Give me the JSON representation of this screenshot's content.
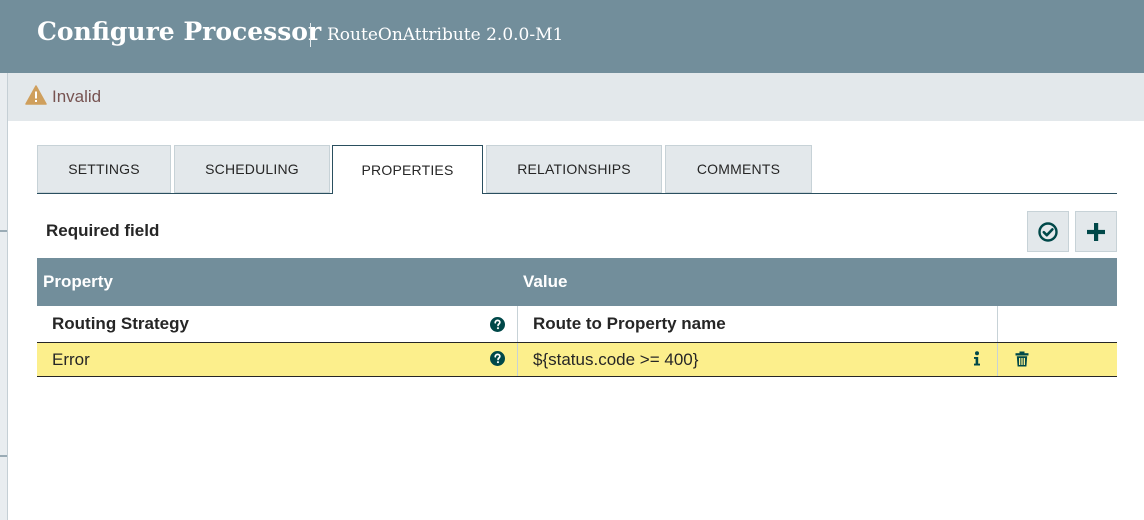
{
  "header": {
    "title": "Configure Processor",
    "subtitle": "RouteOnAttribute 2.0.0-M1"
  },
  "status": {
    "icon": "warning-icon",
    "text": "Invalid",
    "color": "#775351"
  },
  "tabs": [
    {
      "label": "SETTINGS",
      "active": false
    },
    {
      "label": "SCHEDULING",
      "active": false
    },
    {
      "label": "PROPERTIES",
      "active": true
    },
    {
      "label": "RELATIONSHIPS",
      "active": false
    },
    {
      "label": "COMMENTS",
      "active": false
    }
  ],
  "properties": {
    "required_label": "Required field",
    "verify_icon": "check-circle-icon",
    "add_icon": "plus-icon",
    "columns": [
      "Property",
      "Value"
    ],
    "rows": [
      {
        "property": "Routing Strategy",
        "value": "Route to Property name",
        "required": true,
        "highlighted": false
      },
      {
        "property": "Error",
        "value": "${status.code >= 400}",
        "required": false,
        "highlighted": true
      }
    ]
  },
  "colors": {
    "header_bg": "#728e9b",
    "accent": "#004849",
    "highlight_row": "#fcef8c",
    "warning": "#cf9f5d"
  }
}
